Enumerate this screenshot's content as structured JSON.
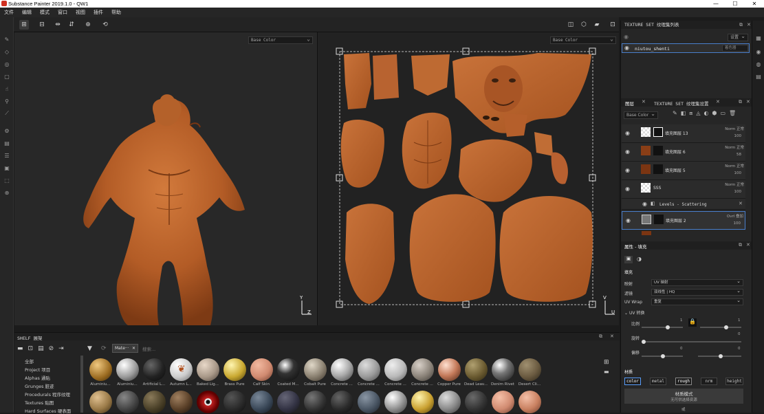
{
  "window": {
    "title": "Substance Painter 2019.1.0 - QW1",
    "minimize": "—",
    "maximize": "☐",
    "close": "✕"
  },
  "menu": [
    "文件",
    "编辑",
    "模式",
    "窗口",
    "视图",
    "插件",
    "帮助"
  ],
  "viewport": {
    "left_channel": "Base Color",
    "right_channel": "Base Color"
  },
  "texture_set_list": {
    "title": "TEXTURE SET 纹理集列表",
    "settings_label": "设置",
    "item_name": "niutou_shenti",
    "shader_label": "着色器"
  },
  "layers_panel": {
    "tab1": "图层",
    "tab2": "TEXTURE SET 纹理集设置",
    "channel": "Base Color",
    "layers": [
      {
        "name": "填充图层 13",
        "blend": "Norm",
        "blend2": "正常",
        "opacity": "100"
      },
      {
        "name": "填充图层 6",
        "blend": "Norm",
        "blend2": "正常",
        "opacity": "58"
      },
      {
        "name": "填充图层 5",
        "blend": "Norm",
        "blend2": "正常",
        "opacity": "100"
      },
      {
        "name": "SSS",
        "blend": "Norm",
        "blend2": "正常",
        "opacity": "100"
      },
      {
        "name": "填充图层 2",
        "blend": "Ovrl",
        "blend2": "叠加",
        "opacity": "100"
      }
    ],
    "sublayer": "Levels - Scattering"
  },
  "properties": {
    "title": "属性 - 填充",
    "section": "填充",
    "mapping_label": "映射",
    "mapping_value": "UV 映射",
    "filter_label": "滤镜",
    "filter_value": "双线性 | HQ",
    "uvwrap_label": "UV Wrap",
    "uvwrap_value": "重复",
    "uv_transform": "UV 转换",
    "scale_label": "比例",
    "scale_value": "1",
    "scale_value2": "1",
    "rotate_label": "旋转",
    "rotate_value": "0",
    "offset_label": "偏移",
    "offset_value": "0",
    "offset_value2": "0",
    "material_label": "材质",
    "channels": [
      "color",
      "metal",
      "rough",
      "nrm",
      "height"
    ],
    "material_mode": "材质模式",
    "material_mode_sub": "无可供选择资源",
    "bottom_label": "或"
  },
  "shelf": {
    "title": "SHELF 展架",
    "search_tab": "Mate···",
    "search_placeholder": "搜索...",
    "categories": [
      "全部",
      "Project 项目",
      "Alphas 通贴",
      "Grunges 脏迹",
      "Procedurals 程序纹理",
      "Textures 贴图",
      "Hard Surfaces 硬表面"
    ],
    "materials": [
      "Aluminiu...",
      "Aluminiu...",
      "Artificial L...",
      "Autumn L...",
      "Baked Lig...",
      "Brass Pure",
      "Calf Skin",
      "Coated M...",
      "Cobalt Pure",
      "Concrete ...",
      "Concrete ...",
      "Concrete ...",
      "Concrete ...",
      "Copper Pure",
      "Dead Leav...",
      "Denim Rivet",
      "Desert Cli..."
    ]
  },
  "colors": {
    "accent": "#5aa0ff",
    "skin": "#b8612c",
    "panel": "#262626"
  }
}
